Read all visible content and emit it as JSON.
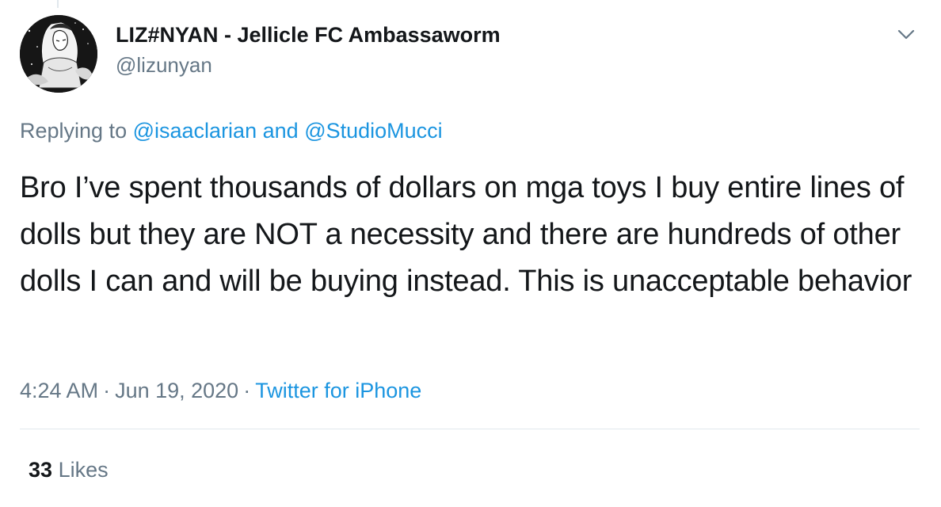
{
  "author": {
    "display_name": "LIZ#NYAN - Jellicle FC Ambassaworm",
    "handle": "@lizunyan"
  },
  "reply": {
    "prefix": "Replying to",
    "users": [
      "@isaaclarian",
      "@StudioMucci"
    ],
    "joiner": "and"
  },
  "tweet": {
    "text": "Bro I’ve spent thousands of dollars on mga toys I buy entire lines of dolls but they are NOT a necessity and there are hundreds of other dolls I can and will be buying instead. This is unacceptable behavior"
  },
  "meta": {
    "time": "4:24 AM",
    "separator": "·",
    "date": "Jun 19, 2020",
    "source": "Twitter for iPhone"
  },
  "stats": {
    "likes_count": "33",
    "likes_label": "Likes"
  },
  "icons": {
    "more": "chevron-down-icon",
    "avatar": "anime-drawing-avatar"
  },
  "colors": {
    "text": "#14171a",
    "secondary": "#657786",
    "link": "#1b95e0",
    "divider": "#e1e8ed"
  }
}
